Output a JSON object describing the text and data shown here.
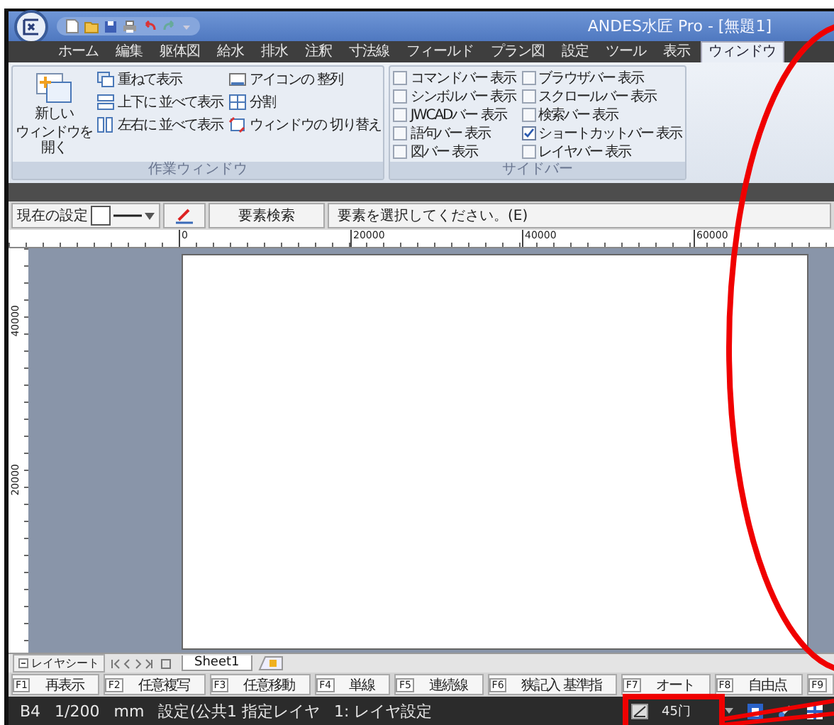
{
  "window": {
    "title": "ANDES水匠 Pro - [無題1]"
  },
  "tabs": [
    {
      "label": "ホーム",
      "selected": false
    },
    {
      "label": "編集",
      "selected": false
    },
    {
      "label": "躯体図",
      "selected": false
    },
    {
      "label": "給水",
      "selected": false
    },
    {
      "label": "排水",
      "selected": false
    },
    {
      "label": "注釈",
      "selected": false
    },
    {
      "label": "寸法線",
      "selected": false
    },
    {
      "label": "フィールド",
      "selected": false
    },
    {
      "label": "プラン図",
      "selected": false
    },
    {
      "label": "設定",
      "selected": false
    },
    {
      "label": "ツール",
      "selected": false
    },
    {
      "label": "表示",
      "selected": false
    },
    {
      "label": "ウィンドウ",
      "selected": true
    }
  ],
  "ribbon": {
    "groups": [
      {
        "title": "作業ウィンドウ",
        "kind": "buttons",
        "large_button": {
          "label_lines": [
            "新しい",
            "ウィンドウを開く"
          ]
        },
        "items": [
          {
            "label": "重ねて表示"
          },
          {
            "label": "上下に 並べて表示"
          },
          {
            "label": "左右に 並べて表示"
          },
          {
            "label": "アイコンの 整列"
          },
          {
            "label": "分割"
          },
          {
            "label": "ウィンドウの 切り替え"
          }
        ]
      },
      {
        "title": "サイドバー",
        "kind": "checks",
        "items": [
          {
            "label": "コマンドバー 表示",
            "checked": false
          },
          {
            "label": "シンボルバー 表示",
            "checked": false
          },
          {
            "label": "JWCADバー 表示",
            "checked": false
          },
          {
            "label": "語句バー 表示",
            "checked": false
          },
          {
            "label": "図バー 表示",
            "checked": false
          },
          {
            "label": "ブラウザバー 表示",
            "checked": false
          },
          {
            "label": "スクロールバー 表示",
            "checked": false
          },
          {
            "label": "検索バー 表示",
            "checked": false
          },
          {
            "label": "ショートカットバー 表示",
            "checked": true
          },
          {
            "label": "レイヤバー 表示",
            "checked": false
          }
        ]
      }
    ]
  },
  "toolbar": {
    "current_label": "現在の設定",
    "search_button": "要素検索",
    "prompt": "要素を選択してください。(E)"
  },
  "ruler": {
    "x_labels": [
      "0",
      "20000",
      "40000",
      "60000"
    ],
    "y_labels": [
      "40000",
      "20000"
    ]
  },
  "sheet_tabs": {
    "layer_tab": "レイヤシート",
    "sheets": [
      {
        "label": "Sheet1",
        "selected": true
      }
    ]
  },
  "function_keys": [
    {
      "key": "F1",
      "label": "再表示"
    },
    {
      "key": "F2",
      "label": "任意複写"
    },
    {
      "key": "F3",
      "label": "任意移動"
    },
    {
      "key": "F4",
      "label": "単線"
    },
    {
      "key": "F5",
      "label": "連続線"
    },
    {
      "key": "F6",
      "label": "狭記入 基準指"
    },
    {
      "key": "F7",
      "label": "オート"
    },
    {
      "key": "F8",
      "label": "自由点"
    },
    {
      "key": "F9"
    }
  ],
  "status_bar": {
    "cells": [
      "B4",
      "1/200",
      "mm",
      "設定(公共1 指定レイヤ",
      "1: レイヤ設定"
    ],
    "angle": "45门"
  }
}
